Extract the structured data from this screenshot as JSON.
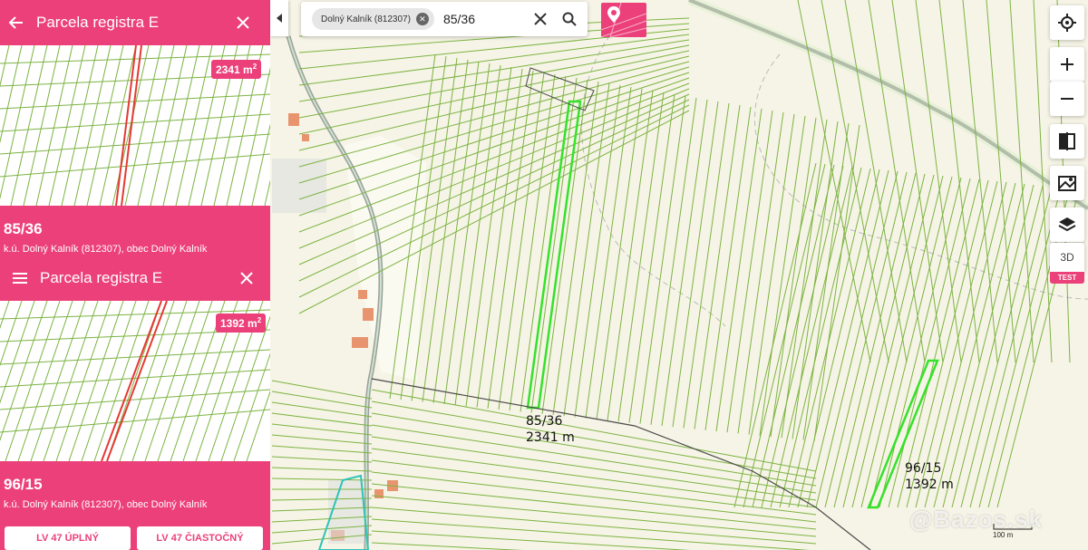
{
  "panel_top": {
    "title": "Parcela registra E",
    "area": "2341 m",
    "area_unit_power": "2",
    "parcel_number": "85/36",
    "location": "k.ú. Dolný Kalník (812307), obec Dolný Kalník"
  },
  "panel_bottom": {
    "title": "Parcela registra E",
    "area": "1392 m",
    "area_unit_power": "2",
    "parcel_number": "96/15",
    "location": "k.ú. Dolný Kalník (812307), obec Dolný Kalník",
    "buttons": [
      "LV 47 ÚPLNÝ",
      "LV 47 ČIASTOČNÝ"
    ]
  },
  "search": {
    "chip_label": "Dolný Kalník (812307)",
    "query": "85/36"
  },
  "map_labels": {
    "parcel_a_number": "85/36",
    "parcel_a_area": "2341 m",
    "parcel_b_number": "96/15",
    "parcel_b_area": "1392 m"
  },
  "toolbar": {
    "three_d_label": "3D",
    "test_badge": "TEST"
  },
  "scale_label": "100 m",
  "watermark": "@Bazos.sk",
  "colors": {
    "accent": "#ec407a",
    "parcel_line": "#7cb342",
    "highlight_line": "#35e22b",
    "selected_line": "#e53935",
    "map_bg": "#f6f4e6"
  }
}
